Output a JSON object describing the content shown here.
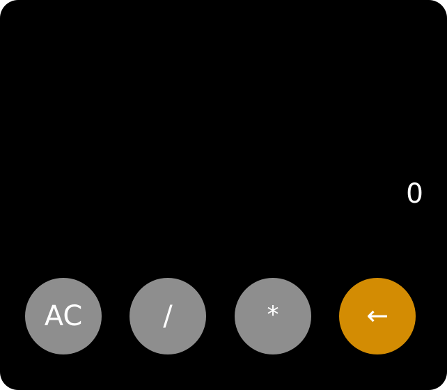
{
  "display": {
    "value": "0"
  },
  "keys": [
    {
      "label": "AC",
      "name": "all-clear-button"
    },
    {
      "label": "/",
      "name": "divide-button"
    },
    {
      "label": "*",
      "name": "multiply-button"
    },
    {
      "label": "←",
      "name": "backspace-button"
    }
  ],
  "colors": {
    "background": "#000000",
    "function_key": "#8e8e8e",
    "accent_key": "#d38c03",
    "text": "#ffffff"
  },
  "icons": {
    "backspace": "left-arrow-icon"
  }
}
